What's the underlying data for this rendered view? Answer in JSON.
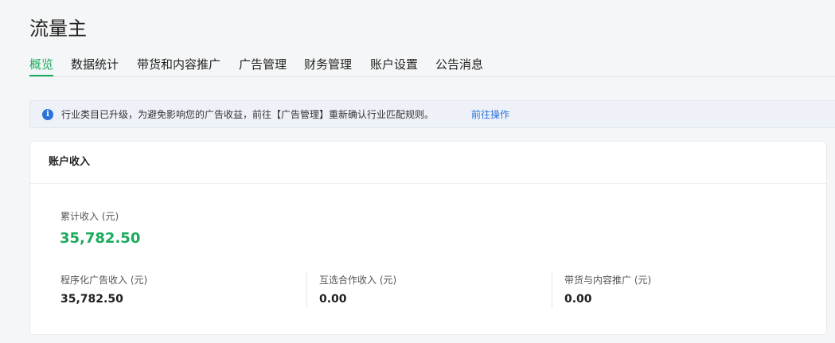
{
  "app": {
    "title": "流量主"
  },
  "tabs": [
    {
      "label": "概览",
      "active": true
    },
    {
      "label": "数据统计",
      "active": false
    },
    {
      "label": "带货和内容推广",
      "active": false
    },
    {
      "label": "广告管理",
      "active": false
    },
    {
      "label": "财务管理",
      "active": false
    },
    {
      "label": "账户设置",
      "active": false
    },
    {
      "label": "公告消息",
      "active": false
    }
  ],
  "notice": {
    "icon": "info-icon",
    "text": "行业类目已升级，为避免影响您的广告收益，前往【广告管理】重新确认行业匹配规则。",
    "link_label": "前往操作"
  },
  "account_income": {
    "title": "账户收入",
    "total_label": "累计收入 (元)",
    "total_value": "35,782.50",
    "metrics": [
      {
        "label": "程序化广告收入 (元)",
        "value": "35,782.50"
      },
      {
        "label": "互选合作收入 (元)",
        "value": "0.00"
      },
      {
        "label": "带货与内容推广 (元)",
        "value": "0.00"
      }
    ]
  },
  "colors": {
    "accent": "#1aab5c",
    "link": "#2a73d9",
    "notice_bg": "#eef2f8"
  }
}
